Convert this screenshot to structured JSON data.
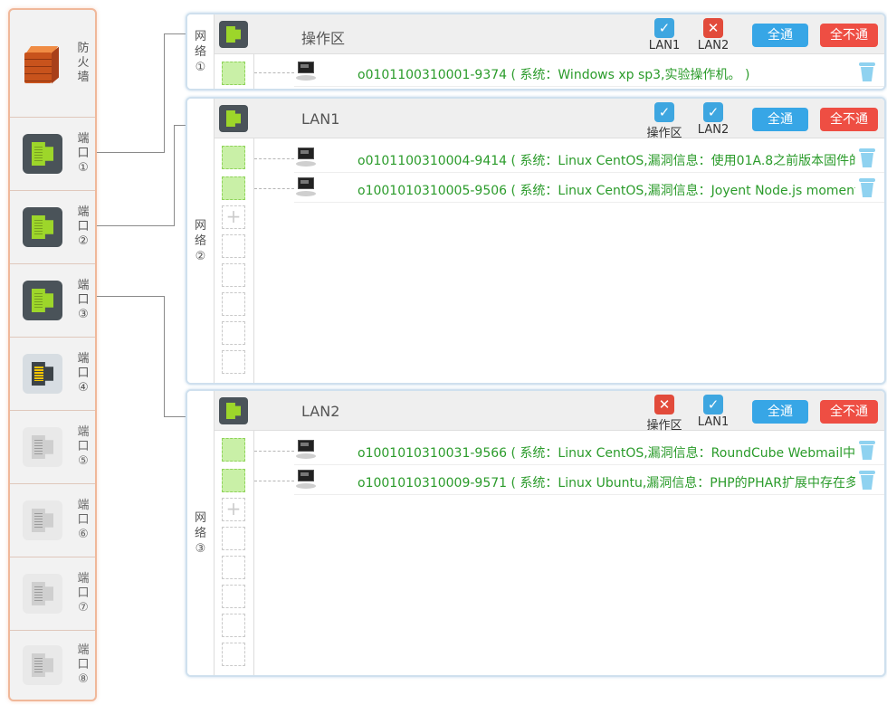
{
  "sidebar": {
    "firewall_label": "防\n火\n墙",
    "ports": [
      {
        "label": "端\n口\n①",
        "state": "active"
      },
      {
        "label": "端\n口\n②",
        "state": "active"
      },
      {
        "label": "端\n口\n③",
        "state": "active"
      },
      {
        "label": "端\n口\n④",
        "state": "yellow"
      },
      {
        "label": "端\n口\n⑤",
        "state": "off"
      },
      {
        "label": "端\n口\n⑥",
        "state": "off"
      },
      {
        "label": "端\n口\n⑦",
        "state": "off"
      },
      {
        "label": "端\n口\n⑧",
        "state": "off"
      }
    ]
  },
  "networks": [
    {
      "label": "网\n络\n①",
      "title": "操作区",
      "checks": [
        {
          "caption": "LAN1",
          "checked": true,
          "mark": "✓"
        },
        {
          "caption": "LAN2",
          "checked": false,
          "mark": "✕"
        }
      ],
      "btn_all": "全通",
      "btn_none": "全不通",
      "hosts": [
        "o0101100310001-9374 ( 系统：Windows xp sp3,实验操作机。 )"
      ]
    },
    {
      "label": "网\n络\n②",
      "title": "LAN1",
      "checks": [
        {
          "caption": "操作区",
          "checked": true,
          "mark": "✓"
        },
        {
          "caption": "LAN2",
          "checked": true,
          "mark": "✓"
        }
      ],
      "btn_all": "全通",
      "btn_none": "全不通",
      "hosts": [
        "o0101100310004-9414 ( 系统：Linux CentOS,漏洞信息：使用01A.8之前版本固件的",
        "o1001010310005-9506 ( 系统：Linux CentOS,漏洞信息：Joyent Node.js moment"
      ]
    },
    {
      "label": "网\n络\n③",
      "title": "LAN2",
      "checks": [
        {
          "caption": "操作区",
          "checked": false,
          "mark": "✕"
        },
        {
          "caption": "LAN1",
          "checked": true,
          "mark": "✓"
        }
      ],
      "btn_all": "全通",
      "btn_none": "全不通",
      "hosts": [
        "o1001010310031-9566 ( 系统：Linux CentOS,漏洞信息：RoundCube Webmail中",
        "o1001010310009-9571 ( 系统：Linux Ubuntu,漏洞信息：PHP的PHAR扩展中存在多"
      ]
    }
  ]
}
